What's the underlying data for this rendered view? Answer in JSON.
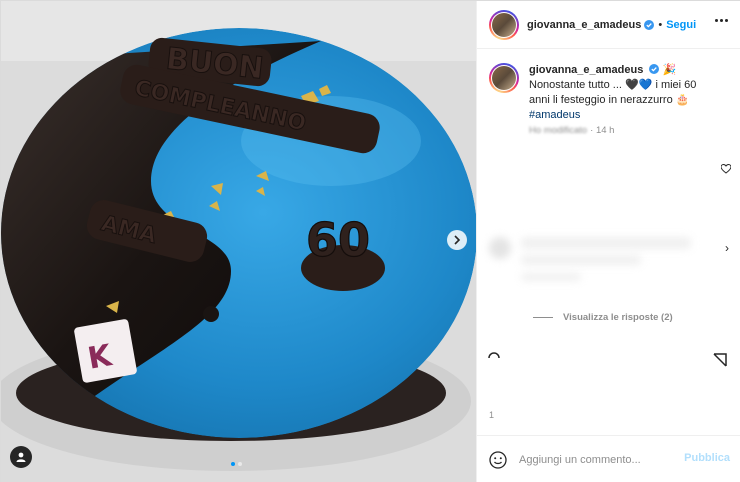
{
  "header": {
    "username": "giovanna_e_amadeus",
    "separator": "•",
    "follow_label": "Segui",
    "more_icon": "more-horizontal-icon"
  },
  "caption": {
    "username": "giovanna_e_amadeus",
    "text_line1": "Nonostante tutto ... 🖤💙 i miei 60",
    "text_line2": "anni li festeggio in nerazzurro 🎂",
    "hashtag": "#amadeus",
    "meta_blurred": "Ho modificato",
    "time": "· 14 h",
    "party_emoji": "🎉"
  },
  "comments": {
    "view_replies_label": "Visualizza le risposte (2)"
  },
  "composer": {
    "placeholder": "Aggiungi un commento...",
    "publish_label": "Pubblica"
  },
  "cake_photo": {
    "topper_1": "BUON",
    "topper_2": "COMPLEANNO",
    "topper_3": "AMA",
    "topper_4": "60",
    "brand_letter": "K"
  },
  "colors": {
    "accent_blue": "#0095f6",
    "cake_blue": "#1e88c9",
    "cake_black": "#1a1412",
    "publish_disabled": "#b2dffc"
  },
  "media": {
    "slide_count": 2,
    "active_slide": 1
  }
}
